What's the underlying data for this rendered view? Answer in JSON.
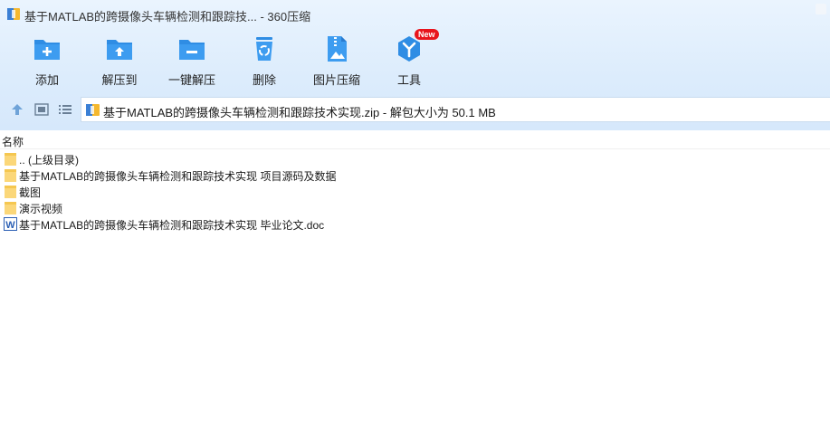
{
  "window": {
    "title": "基于MATLAB的跨摄像头车辆检测和跟踪技...  - 360压缩"
  },
  "toolbar": {
    "items": [
      {
        "label": "添加",
        "icon": "add-folder-icon"
      },
      {
        "label": "解压到",
        "icon": "extract-to-icon"
      },
      {
        "label": "一键解压",
        "icon": "one-click-extract-icon"
      },
      {
        "label": "删除",
        "icon": "recycle-bin-icon"
      },
      {
        "label": "图片压缩",
        "icon": "image-compress-icon"
      },
      {
        "label": "工具",
        "icon": "tools-icon"
      }
    ],
    "new_badge": "New"
  },
  "address": {
    "path": "基于MATLAB的跨摄像头车辆检测和跟踪技术实现.zip - 解包大小为 50.1 MB"
  },
  "file_list": {
    "column_name": "名称",
    "rows": [
      {
        "name": ".. (上级目录)",
        "type": "folder"
      },
      {
        "name": "基于MATLAB的跨摄像头车辆检测和跟踪技术实现 项目源码及数据",
        "type": "folder"
      },
      {
        "name": "截图",
        "type": "folder"
      },
      {
        "name": "演示视频",
        "type": "folder"
      },
      {
        "name": "基于MATLAB的跨摄像头车辆检测和跟踪技术实现 毕业论文.doc",
        "type": "word-doc"
      }
    ]
  },
  "colors": {
    "accent": "#2f8de4",
    "header_bg": "#dcecfc",
    "badge": "#e8141c"
  }
}
